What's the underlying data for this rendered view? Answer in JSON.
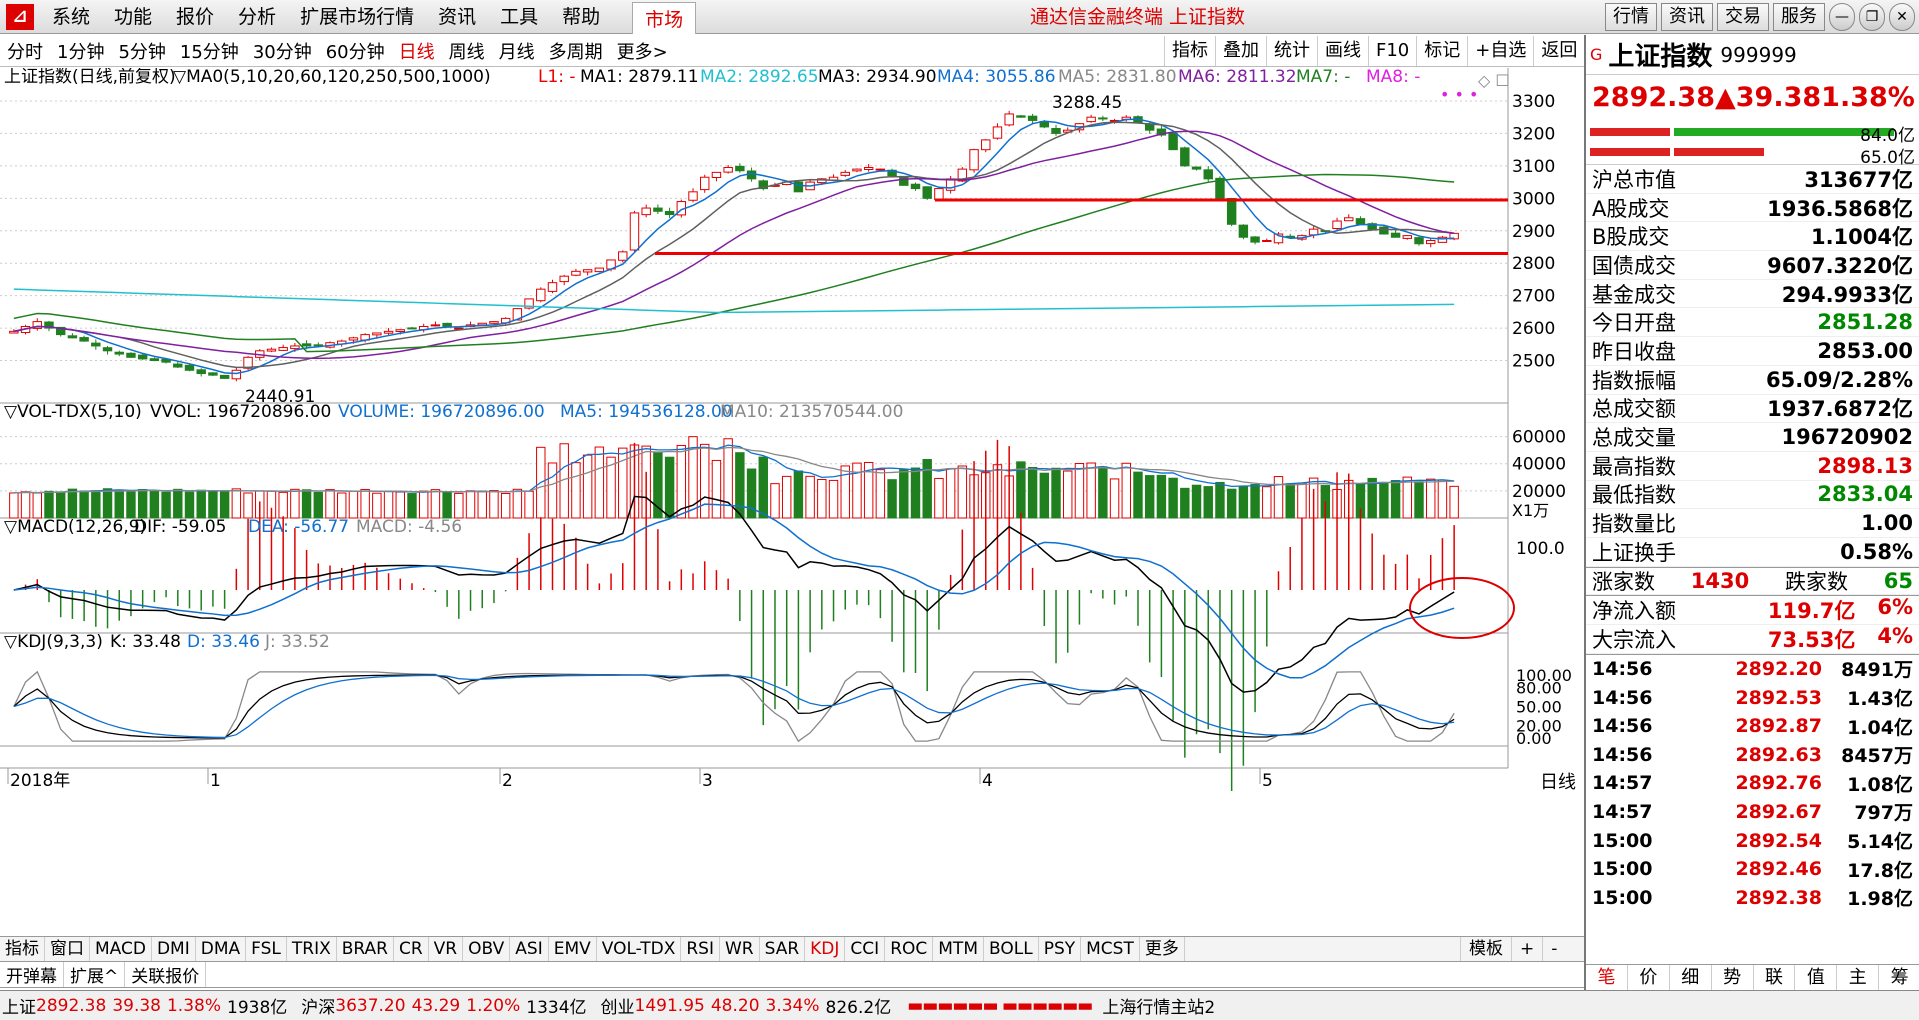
{
  "menu": {
    "items": [
      "系统",
      "功能",
      "报价",
      "分析",
      "扩展市场行情",
      "资讯",
      "工具",
      "帮助"
    ],
    "active_tab": "市场",
    "title": "通达信金融终端 上证指数",
    "right_buttons": [
      "行情",
      "资讯",
      "交易",
      "服务"
    ]
  },
  "periods": {
    "items": [
      "分时",
      "1分钟",
      "5分钟",
      "15分钟",
      "30分钟",
      "60分钟",
      "日线",
      "周线",
      "月线",
      "多周期",
      "更多>"
    ],
    "selected": "日线"
  },
  "tools": [
    "指标",
    "叠加",
    "统计",
    "画线",
    "F10",
    "标记",
    "+自选",
    "返回"
  ],
  "main_legend": {
    "title": "上证指数(日线,前复权)",
    "ma0": "▽MA0(5,10,20,60,120,250,500,1000)",
    "l1": "L1: -",
    "ma1": "MA1: 2879.11",
    "ma2": "MA2: 2892.65",
    "ma3": "MA3: 2934.90",
    "ma4": "MA4: 3055.86",
    "ma5": "MA5: 2831.80",
    "ma6": "MA6: 2811.32",
    "ma7": "MA7: -",
    "ma8": "MA8: -"
  },
  "vol_legend": {
    "title": "▽VOL-TDX(5,10)",
    "vvol": "VVOL: 196720896.00",
    "volume": "VOLUME: 196720896.00",
    "ma5": "MA5: 194536128.00",
    "ma10": "MA10: 213570544.00",
    "unit": "X1万"
  },
  "macd_legend": {
    "title": "▽MACD(12,26,9)",
    "dif": "DIF: -59.05",
    "dea": "DEA: -56.77",
    "macd": "MACD: -4.56"
  },
  "kdj_legend": {
    "title": "▽KDJ(9,3,3)",
    "k": "K: 33.48",
    "d": "D: 33.46",
    "j": "J: 33.52"
  },
  "annotations": {
    "high": "3288.45",
    "low": "2440.91"
  },
  "axes": {
    "price_ticks": [
      "3300",
      "3200",
      "3100",
      "3000",
      "2900",
      "2800",
      "2700",
      "2600",
      "2500"
    ],
    "vol_ticks": [
      "60000",
      "40000",
      "20000"
    ],
    "macd_ticks": [
      "100.0"
    ],
    "kdj_ticks": [
      "100.00",
      "80.00",
      "50.00",
      "20.00",
      "0.00"
    ],
    "months": [
      "2018年",
      "1",
      "2",
      "3",
      "4",
      "5"
    ],
    "period_label": "日线"
  },
  "quote": {
    "g": "G",
    "name": "上证指数",
    "code": "999999",
    "price": "2892.38",
    "change": "▲39.38",
    "pct": "1.38%",
    "bar1": "84.0亿",
    "bar2": "65.0亿"
  },
  "stats": [
    {
      "label": "沪总市值",
      "value": "313677亿",
      "color": "blk"
    },
    {
      "label": "A股成交",
      "value": "1936.5868亿",
      "color": "blk"
    },
    {
      "label": "B股成交",
      "value": "1.1004亿",
      "color": "blk"
    },
    {
      "label": "国债成交",
      "value": "9607.3220亿",
      "color": "blk"
    },
    {
      "label": "基金成交",
      "value": "294.9933亿",
      "color": "blk"
    },
    {
      "label": "今日开盘",
      "value": "2851.28",
      "color": "grn"
    },
    {
      "label": "昨日收盘",
      "value": "2853.00",
      "color": "blk"
    },
    {
      "label": "指数振幅",
      "value": "65.09/2.28%",
      "color": "blk"
    },
    {
      "label": "总成交额",
      "value": "1937.6872亿",
      "color": "blk"
    },
    {
      "label": "总成交量",
      "value": "196720902",
      "color": "blk"
    },
    {
      "label": "最高指数",
      "value": "2898.13",
      "color": "red"
    },
    {
      "label": "最低指数",
      "value": "2833.04",
      "color": "grn"
    },
    {
      "label": "指数量比",
      "value": "1.00",
      "color": "blk"
    },
    {
      "label": "上证换手",
      "value": "0.58%",
      "color": "blk"
    }
  ],
  "updown": {
    "up_label": "涨家数",
    "up": "1430",
    "down_label": "跌家数",
    "down": "65"
  },
  "flows": [
    {
      "label": "净流入额",
      "value": "119.7亿",
      "pct": "6%"
    },
    {
      "label": "大宗流入",
      "value": "73.53亿",
      "pct": "4%"
    }
  ],
  "ticks": [
    {
      "t": "14:56",
      "p": "2892.20",
      "v": "8491万"
    },
    {
      "t": "14:56",
      "p": "2892.53",
      "v": "1.43亿"
    },
    {
      "t": "14:56",
      "p": "2892.87",
      "v": "1.04亿"
    },
    {
      "t": "14:56",
      "p": "2892.63",
      "v": "8457万"
    },
    {
      "t": "14:57",
      "p": "2892.76",
      "v": "1.08亿"
    },
    {
      "t": "14:57",
      "p": "2892.67",
      "v": "797万"
    },
    {
      "t": "15:00",
      "p": "2892.54",
      "v": "5.14亿"
    },
    {
      "t": "15:00",
      "p": "2892.46",
      "v": "17.8亿"
    },
    {
      "t": "15:00",
      "p": "2892.38",
      "v": "1.98亿"
    }
  ],
  "rp_tabs": [
    "笔",
    "价",
    "细",
    "势",
    "联",
    "值",
    "主",
    "筹"
  ],
  "indicators": [
    "指标",
    "窗口",
    "MACD",
    "DMI",
    "DMA",
    "FSL",
    "TRIX",
    "BRAR",
    "CR",
    "VR",
    "OBV",
    "ASI",
    "EMV",
    "VOL-TDX",
    "RSI",
    "WR",
    "SAR",
    "KDJ",
    "CCI",
    "ROC",
    "MTM",
    "BOLL",
    "PSY",
    "MCST",
    "更多"
  ],
  "ind_selected": "KDJ",
  "mod_buttons": [
    "模板",
    "+",
    "-"
  ],
  "subbar": [
    "开弹幕",
    "扩展^",
    "关联报价"
  ],
  "status": {
    "sh": "上证",
    "sh_v": "2892.38",
    "sh_c": "39.38",
    "sh_p": "1.38%",
    "sh_amt": "1938亿",
    "sz": "沪深",
    "sz_v": "3637.20",
    "sz_c": "43.29",
    "sz_p": "1.20%",
    "sz_amt": "1334亿",
    "cy": "创业",
    "cy_v": "1491.95",
    "cy_c": "48.20",
    "cy_p": "3.34%",
    "cy_amt": "826.2亿",
    "station": "上海行情主站2"
  },
  "colors": {
    "up": "#e00000",
    "down": "#208020",
    "ma1": "#606060",
    "ma2": "#1070d0",
    "ma3": "#8020a0",
    "ma4": "#208020",
    "ma5": "#20c0d0"
  },
  "chart_data": {
    "type": "candlestick",
    "price_range": [
      2400,
      3340
    ],
    "support_lines": [
      2830,
      2995
    ],
    "closes": [
      2590,
      2605,
      2620,
      2600,
      2580,
      2570,
      2560,
      2545,
      2530,
      2520,
      2510,
      2505,
      2500,
      2495,
      2480,
      2470,
      2460,
      2455,
      2445,
      2470,
      2510,
      2530,
      2535,
      2540,
      2545,
      2545,
      2548,
      2555,
      2560,
      2570,
      2580,
      2585,
      2590,
      2595,
      2600,
      2605,
      2610,
      2605,
      2600,
      2610,
      2615,
      2620,
      2630,
      2660,
      2690,
      2720,
      2740,
      2760,
      2775,
      2780,
      2785,
      2810,
      2835,
      2955,
      2970,
      2960,
      2950,
      2990,
      3020,
      3065,
      3080,
      3095,
      3085,
      3060,
      3030,
      3040,
      3050,
      3020,
      3050,
      3060,
      3065,
      3080,
      3090,
      3095,
      3090,
      3070,
      3040,
      3030,
      3000,
      3030,
      3060,
      3090,
      3150,
      3180,
      3220,
      3260,
      3250,
      3240,
      3220,
      3200,
      3210,
      3230,
      3250,
      3245,
      3240,
      3250,
      3235,
      3210,
      3195,
      3150,
      3100,
      3090,
      3060,
      3000,
      2920,
      2880,
      2865,
      2870,
      2890,
      2880,
      2885,
      2905,
      2900,
      2930,
      2940,
      2920,
      2905,
      2890,
      2880,
      2885,
      2860,
      2870,
      2880,
      2892
    ]
  }
}
